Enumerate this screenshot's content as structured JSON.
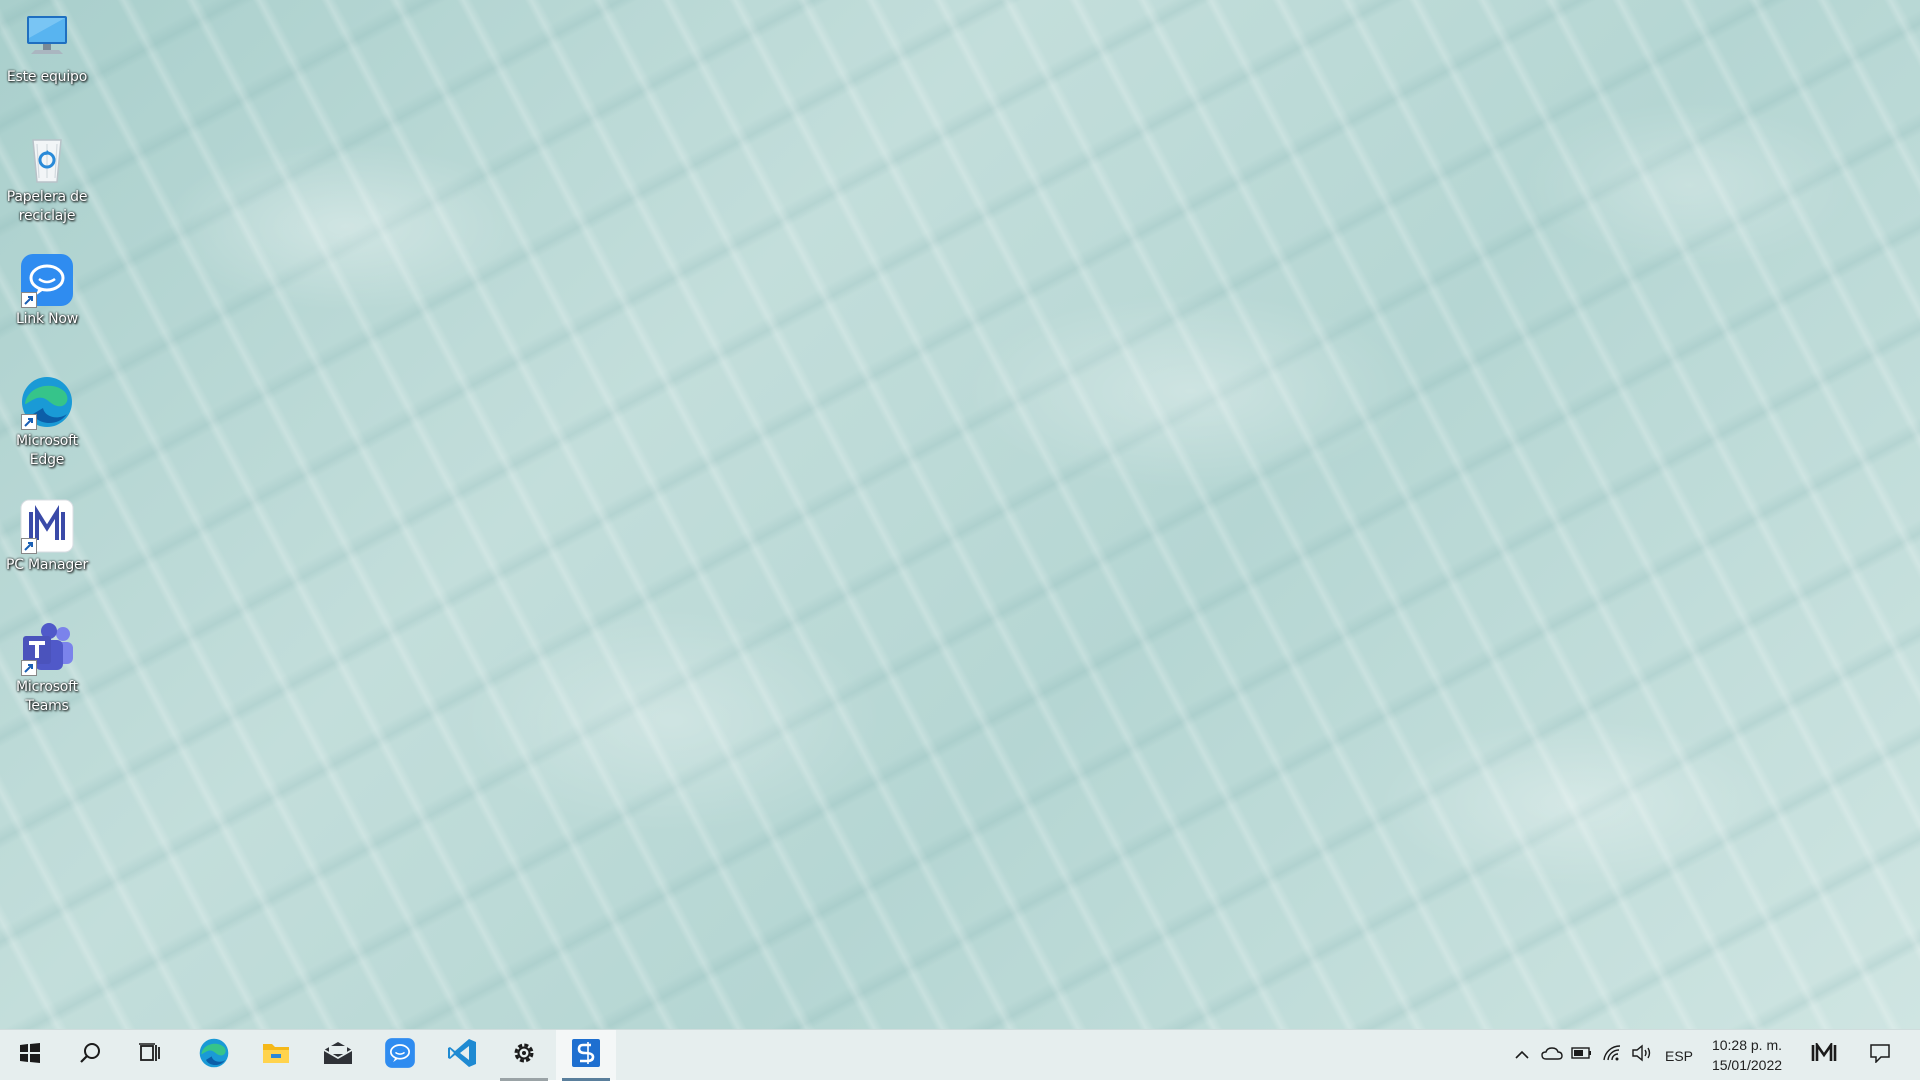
{
  "desktop": {
    "icons": [
      {
        "label": "Este equipo",
        "icon": "computer-icon"
      },
      {
        "label": "Papelera de reciclaje",
        "icon": "recycle-bin-icon"
      },
      {
        "label": "Link Now",
        "icon": "link-now-icon"
      },
      {
        "label": "Microsoft Edge",
        "icon": "edge-icon"
      },
      {
        "label": "PC Manager",
        "icon": "pc-manager-icon"
      },
      {
        "label": "Microsoft Teams",
        "icon": "teams-icon"
      }
    ]
  },
  "taskbar": {
    "pinned": [
      "start-icon",
      "search-icon",
      "task-view-icon",
      "edge-icon",
      "file-explorer-icon",
      "mail-icon",
      "link-now-icon",
      "vscode-icon",
      "settings-icon",
      "app-s-icon"
    ],
    "tray": {
      "language": "ESP",
      "time": "10:28 p. m.",
      "date": "15/01/2022"
    }
  },
  "colors": {
    "taskbar_bg": "#e6eeee",
    "accent": "#2b88d8",
    "active_indicator": "#5a7f9c"
  }
}
